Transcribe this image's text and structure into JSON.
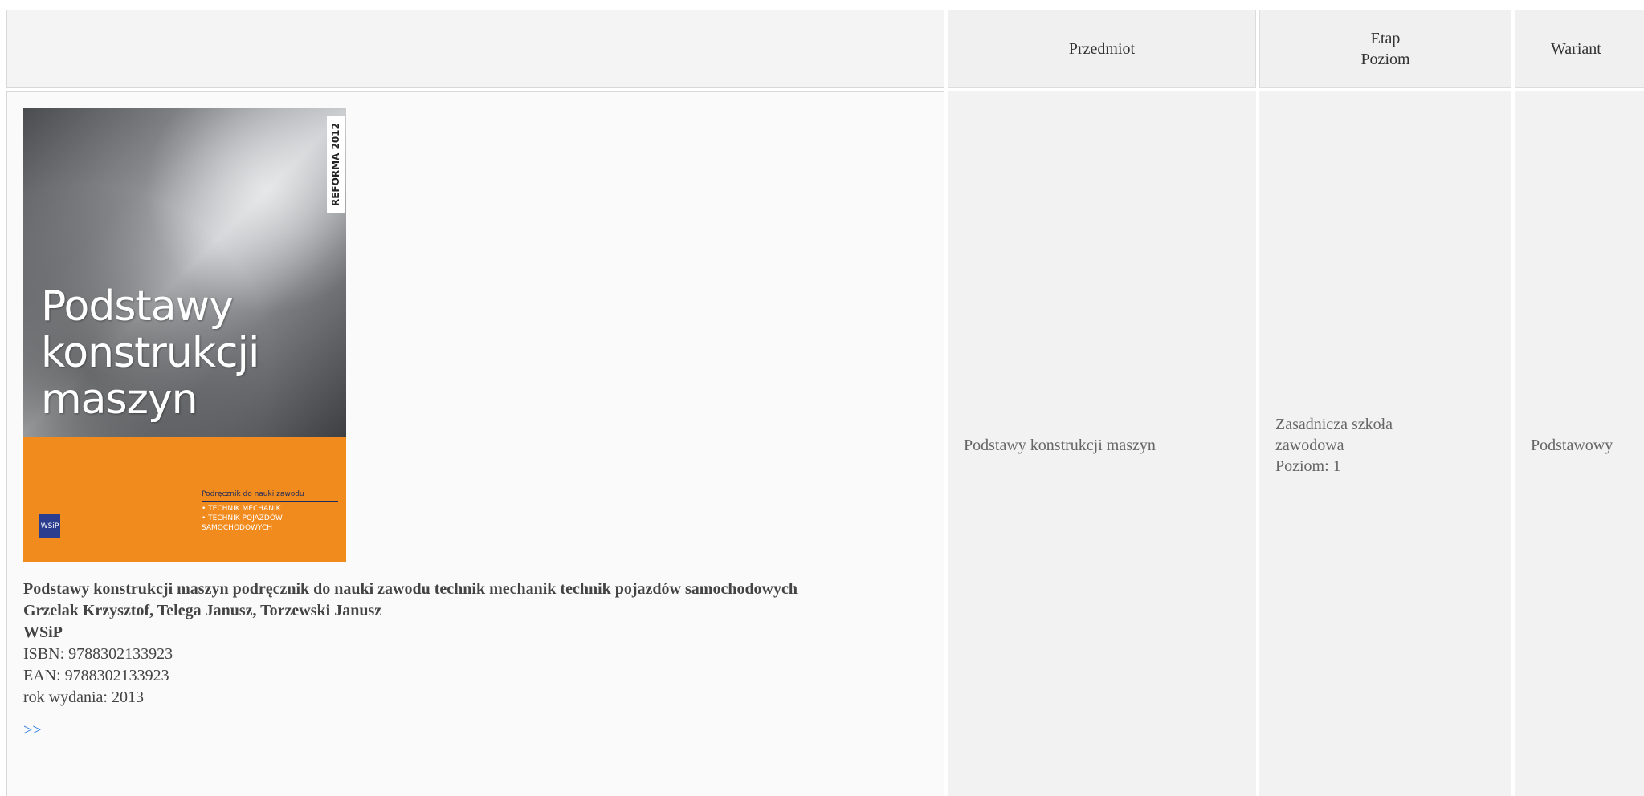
{
  "header": {
    "col_subject": "Przedmiot",
    "col_stage_line1": "Etap",
    "col_stage_line2": "Poziom",
    "col_variant": "Wariant"
  },
  "book": {
    "cover": {
      "title_line1": "Podstawy",
      "title_line2": "konstrukcji",
      "title_line3": "maszyn",
      "side_label": "REFORMA 2012",
      "subtitle_head": "Podręcznik do nauki zawodu",
      "subtitle_item1": "• TECHNIK MECHANIK",
      "subtitle_item2": "• TECHNIK POJAZDÓW SAMOCHODOWYCH",
      "publisher_logo": "WSiP"
    },
    "title": "Podstawy konstrukcji maszyn podręcznik do nauki zawodu technik mechanik technik pojazdów samochodowych",
    "authors": "Grzelak Krzysztof, Telega Janusz, Torzewski Janusz",
    "publisher": "WSiP",
    "isbn": "ISBN: 9788302133923",
    "ean": "EAN: 9788302133923",
    "year": "rok wydania: 2013",
    "more_link": ">>"
  },
  "row": {
    "subject": "Podstawy konstrukcji maszyn",
    "stage_line1": "Zasadnicza szkoła",
    "stage_line2": "zawodowa",
    "level": "Poziom: 1",
    "variant": "Podstawowy"
  }
}
